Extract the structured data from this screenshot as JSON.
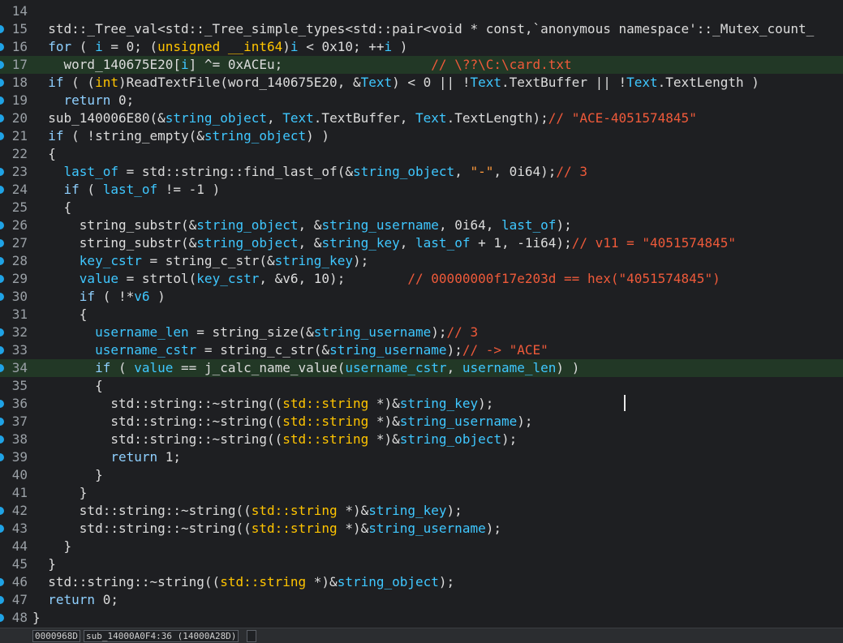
{
  "editor": {
    "first_line_number": 14,
    "lines": [
      {
        "n": "14",
        "dot": false,
        "hl": false,
        "tokens": []
      },
      {
        "n": "15",
        "dot": true,
        "hl": false,
        "tokens": [
          [
            "  ",
            ""
          ],
          [
            "std::_Tree_val<std::_Tree_simple_types<std::pair<void * const,`anonymous namespace'::_Mutex_count_",
            ""
          ]
        ]
      },
      {
        "n": "16",
        "dot": true,
        "hl": false,
        "tokens": [
          [
            "  ",
            ""
          ],
          [
            "for",
            "kw"
          ],
          [
            " ( ",
            ""
          ],
          [
            "i",
            "id"
          ],
          [
            " = 0; (",
            ""
          ],
          [
            "unsigned __int64",
            "ty"
          ],
          [
            ")",
            ""
          ],
          [
            "i",
            "id"
          ],
          [
            " < 0x10; ++",
            ""
          ],
          [
            "i",
            "id"
          ],
          [
            " )",
            ""
          ]
        ]
      },
      {
        "n": "17",
        "dot": true,
        "hl": true,
        "tokens": [
          [
            "    word_140675E20[",
            ""
          ],
          [
            "i",
            "id"
          ],
          [
            "] ^= 0xACEu;",
            ""
          ],
          [
            "                   ",
            ""
          ],
          [
            "// \\??\\C:\\card.txt",
            "cm"
          ]
        ]
      },
      {
        "n": "18",
        "dot": true,
        "hl": false,
        "tokens": [
          [
            "  ",
            ""
          ],
          [
            "if",
            "kw"
          ],
          [
            " ( (",
            ""
          ],
          [
            "int",
            "ty"
          ],
          [
            ")ReadTextFile(word_140675E20, &",
            ""
          ],
          [
            "Text",
            "id"
          ],
          [
            ") < 0 || !",
            ""
          ],
          [
            "Text",
            "id"
          ],
          [
            ".TextBuffer || !",
            ""
          ],
          [
            "Text",
            "id"
          ],
          [
            ".TextLength )",
            ""
          ]
        ]
      },
      {
        "n": "19",
        "dot": true,
        "hl": false,
        "tokens": [
          [
            "    ",
            ""
          ],
          [
            "return",
            "kw"
          ],
          [
            " 0;",
            ""
          ]
        ]
      },
      {
        "n": "20",
        "dot": true,
        "hl": false,
        "tokens": [
          [
            "  sub_140006E80(&",
            ""
          ],
          [
            "string_object",
            "id"
          ],
          [
            ", ",
            ""
          ],
          [
            "Text",
            "id"
          ],
          [
            ".TextBuffer, ",
            ""
          ],
          [
            "Text",
            "id"
          ],
          [
            ".TextLength);",
            ""
          ],
          [
            "// \"ACE-4051574845\"",
            "cm"
          ]
        ]
      },
      {
        "n": "21",
        "dot": true,
        "hl": false,
        "tokens": [
          [
            "  ",
            ""
          ],
          [
            "if",
            "kw"
          ],
          [
            " ( !string_empty(&",
            ""
          ],
          [
            "string_object",
            "id"
          ],
          [
            ") )",
            ""
          ]
        ]
      },
      {
        "n": "22",
        "dot": false,
        "hl": false,
        "tokens": [
          [
            "  {",
            ""
          ]
        ]
      },
      {
        "n": "23",
        "dot": true,
        "hl": false,
        "tokens": [
          [
            "    ",
            ""
          ],
          [
            "last_of",
            "id"
          ],
          [
            " = std::string::find_last_of(&",
            ""
          ],
          [
            "string_object",
            "id"
          ],
          [
            ", ",
            ""
          ],
          [
            "\"-\"",
            "str"
          ],
          [
            ", 0i64);",
            ""
          ],
          [
            "// 3",
            "cm"
          ]
        ]
      },
      {
        "n": "24",
        "dot": true,
        "hl": false,
        "tokens": [
          [
            "    ",
            ""
          ],
          [
            "if",
            "kw"
          ],
          [
            " ( ",
            ""
          ],
          [
            "last_of",
            "id"
          ],
          [
            " != -1 )",
            ""
          ]
        ]
      },
      {
        "n": "25",
        "dot": false,
        "hl": false,
        "tokens": [
          [
            "    {",
            ""
          ]
        ]
      },
      {
        "n": "26",
        "dot": true,
        "hl": false,
        "tokens": [
          [
            "      string_substr(&",
            ""
          ],
          [
            "string_object",
            "id"
          ],
          [
            ", &",
            ""
          ],
          [
            "string_username",
            "id"
          ],
          [
            ", 0i64, ",
            ""
          ],
          [
            "last_of",
            "id"
          ],
          [
            ");",
            ""
          ]
        ]
      },
      {
        "n": "27",
        "dot": true,
        "hl": false,
        "tokens": [
          [
            "      string_substr(&",
            ""
          ],
          [
            "string_object",
            "id"
          ],
          [
            ", &",
            ""
          ],
          [
            "string_key",
            "id"
          ],
          [
            ", ",
            ""
          ],
          [
            "last_of",
            "id"
          ],
          [
            " + 1, -1i64);",
            ""
          ],
          [
            "// v11 = \"4051574845\"",
            "cm"
          ]
        ]
      },
      {
        "n": "28",
        "dot": true,
        "hl": false,
        "tokens": [
          [
            "      ",
            ""
          ],
          [
            "key_cstr",
            "id"
          ],
          [
            " = string_c_str(&",
            ""
          ],
          [
            "string_key",
            "id"
          ],
          [
            ");",
            ""
          ]
        ]
      },
      {
        "n": "29",
        "dot": true,
        "hl": false,
        "tokens": [
          [
            "      ",
            ""
          ],
          [
            "value",
            "id"
          ],
          [
            " = strtol(",
            ""
          ],
          [
            "key_cstr",
            "id"
          ],
          [
            ", &v6, 10);",
            ""
          ],
          [
            "        ",
            ""
          ],
          [
            "// 00000000f17e203d == hex(\"4051574845\")",
            "cm"
          ]
        ]
      },
      {
        "n": "30",
        "dot": true,
        "hl": false,
        "tokens": [
          [
            "      ",
            ""
          ],
          [
            "if",
            "kw"
          ],
          [
            " ( !*",
            ""
          ],
          [
            "v6",
            "id"
          ],
          [
            " )",
            ""
          ]
        ]
      },
      {
        "n": "31",
        "dot": false,
        "hl": false,
        "tokens": [
          [
            "      {",
            ""
          ]
        ]
      },
      {
        "n": "32",
        "dot": true,
        "hl": false,
        "tokens": [
          [
            "        ",
            ""
          ],
          [
            "username_len",
            "id"
          ],
          [
            " = string_size(&",
            ""
          ],
          [
            "string_username",
            "id"
          ],
          [
            ");",
            ""
          ],
          [
            "// 3",
            "cm"
          ]
        ]
      },
      {
        "n": "33",
        "dot": true,
        "hl": false,
        "tokens": [
          [
            "        ",
            ""
          ],
          [
            "username_cstr",
            "id"
          ],
          [
            " = string_c_str(&",
            ""
          ],
          [
            "string_username",
            "id"
          ],
          [
            ");",
            ""
          ],
          [
            "// -> \"ACE\"",
            "cm"
          ]
        ]
      },
      {
        "n": "34",
        "dot": true,
        "hl": true,
        "tokens": [
          [
            "        ",
            ""
          ],
          [
            "if",
            "kw"
          ],
          [
            " ( ",
            ""
          ],
          [
            "value",
            "id"
          ],
          [
            " == j_calc_name_value(",
            ""
          ],
          [
            "username_cstr",
            "id"
          ],
          [
            ", ",
            ""
          ],
          [
            "username_len",
            "id"
          ],
          [
            ") )",
            ""
          ]
        ]
      },
      {
        "n": "35",
        "dot": false,
        "hl": false,
        "tokens": [
          [
            "        {",
            ""
          ]
        ]
      },
      {
        "n": "36",
        "dot": true,
        "hl": false,
        "tokens": [
          [
            "          std::string::~string((",
            ""
          ],
          [
            "std::string",
            "ty"
          ],
          [
            " *)&",
            ""
          ],
          [
            "string_key",
            "id"
          ],
          [
            ");",
            ""
          ]
        ]
      },
      {
        "n": "37",
        "dot": true,
        "hl": false,
        "tokens": [
          [
            "          std::string::~string((",
            ""
          ],
          [
            "std::string",
            "ty"
          ],
          [
            " *)&",
            ""
          ],
          [
            "string_username",
            "id"
          ],
          [
            ");",
            ""
          ]
        ]
      },
      {
        "n": "38",
        "dot": true,
        "hl": false,
        "tokens": [
          [
            "          std::string::~string((",
            ""
          ],
          [
            "std::string",
            "ty"
          ],
          [
            " *)&",
            ""
          ],
          [
            "string_object",
            "id"
          ],
          [
            ");",
            ""
          ]
        ]
      },
      {
        "n": "39",
        "dot": true,
        "hl": false,
        "tokens": [
          [
            "          ",
            ""
          ],
          [
            "return",
            "kw"
          ],
          [
            " 1;",
            ""
          ]
        ]
      },
      {
        "n": "40",
        "dot": false,
        "hl": false,
        "tokens": [
          [
            "        }",
            ""
          ]
        ]
      },
      {
        "n": "41",
        "dot": false,
        "hl": false,
        "tokens": [
          [
            "      }",
            ""
          ]
        ]
      },
      {
        "n": "42",
        "dot": true,
        "hl": false,
        "tokens": [
          [
            "      std::string::~string((",
            ""
          ],
          [
            "std::string",
            "ty"
          ],
          [
            " *)&",
            ""
          ],
          [
            "string_key",
            "id"
          ],
          [
            ");",
            ""
          ]
        ]
      },
      {
        "n": "43",
        "dot": true,
        "hl": false,
        "tokens": [
          [
            "      std::string::~string((",
            ""
          ],
          [
            "std::string",
            "ty"
          ],
          [
            " *)&",
            ""
          ],
          [
            "string_username",
            "id"
          ],
          [
            ");",
            ""
          ]
        ]
      },
      {
        "n": "44",
        "dot": false,
        "hl": false,
        "tokens": [
          [
            "    }",
            ""
          ]
        ]
      },
      {
        "n": "45",
        "dot": false,
        "hl": false,
        "tokens": [
          [
            "  }",
            ""
          ]
        ]
      },
      {
        "n": "46",
        "dot": true,
        "hl": false,
        "tokens": [
          [
            "  std::string::~string((",
            ""
          ],
          [
            "std::string",
            "ty"
          ],
          [
            " *)&",
            ""
          ],
          [
            "string_object",
            "id"
          ],
          [
            ");",
            ""
          ]
        ]
      },
      {
        "n": "47",
        "dot": true,
        "hl": false,
        "tokens": [
          [
            "  ",
            ""
          ],
          [
            "return",
            "kw"
          ],
          [
            " 0;",
            ""
          ]
        ]
      },
      {
        "n": "48",
        "dot": true,
        "hl": false,
        "tokens": [
          [
            "}",
            ""
          ]
        ]
      }
    ]
  },
  "status_bar": {
    "address": "0000968D",
    "location": "sub_14000A0F4:36 (14000A28D)"
  },
  "colors": {
    "background": "#1e1f22",
    "highlight_line": "#223826",
    "keyword": "#8fd0ff",
    "type": "#ffc400",
    "identifier": "#3fc7ff",
    "comment": "#ef5a3a",
    "breakpoint_dot": "#1fa3e6"
  }
}
